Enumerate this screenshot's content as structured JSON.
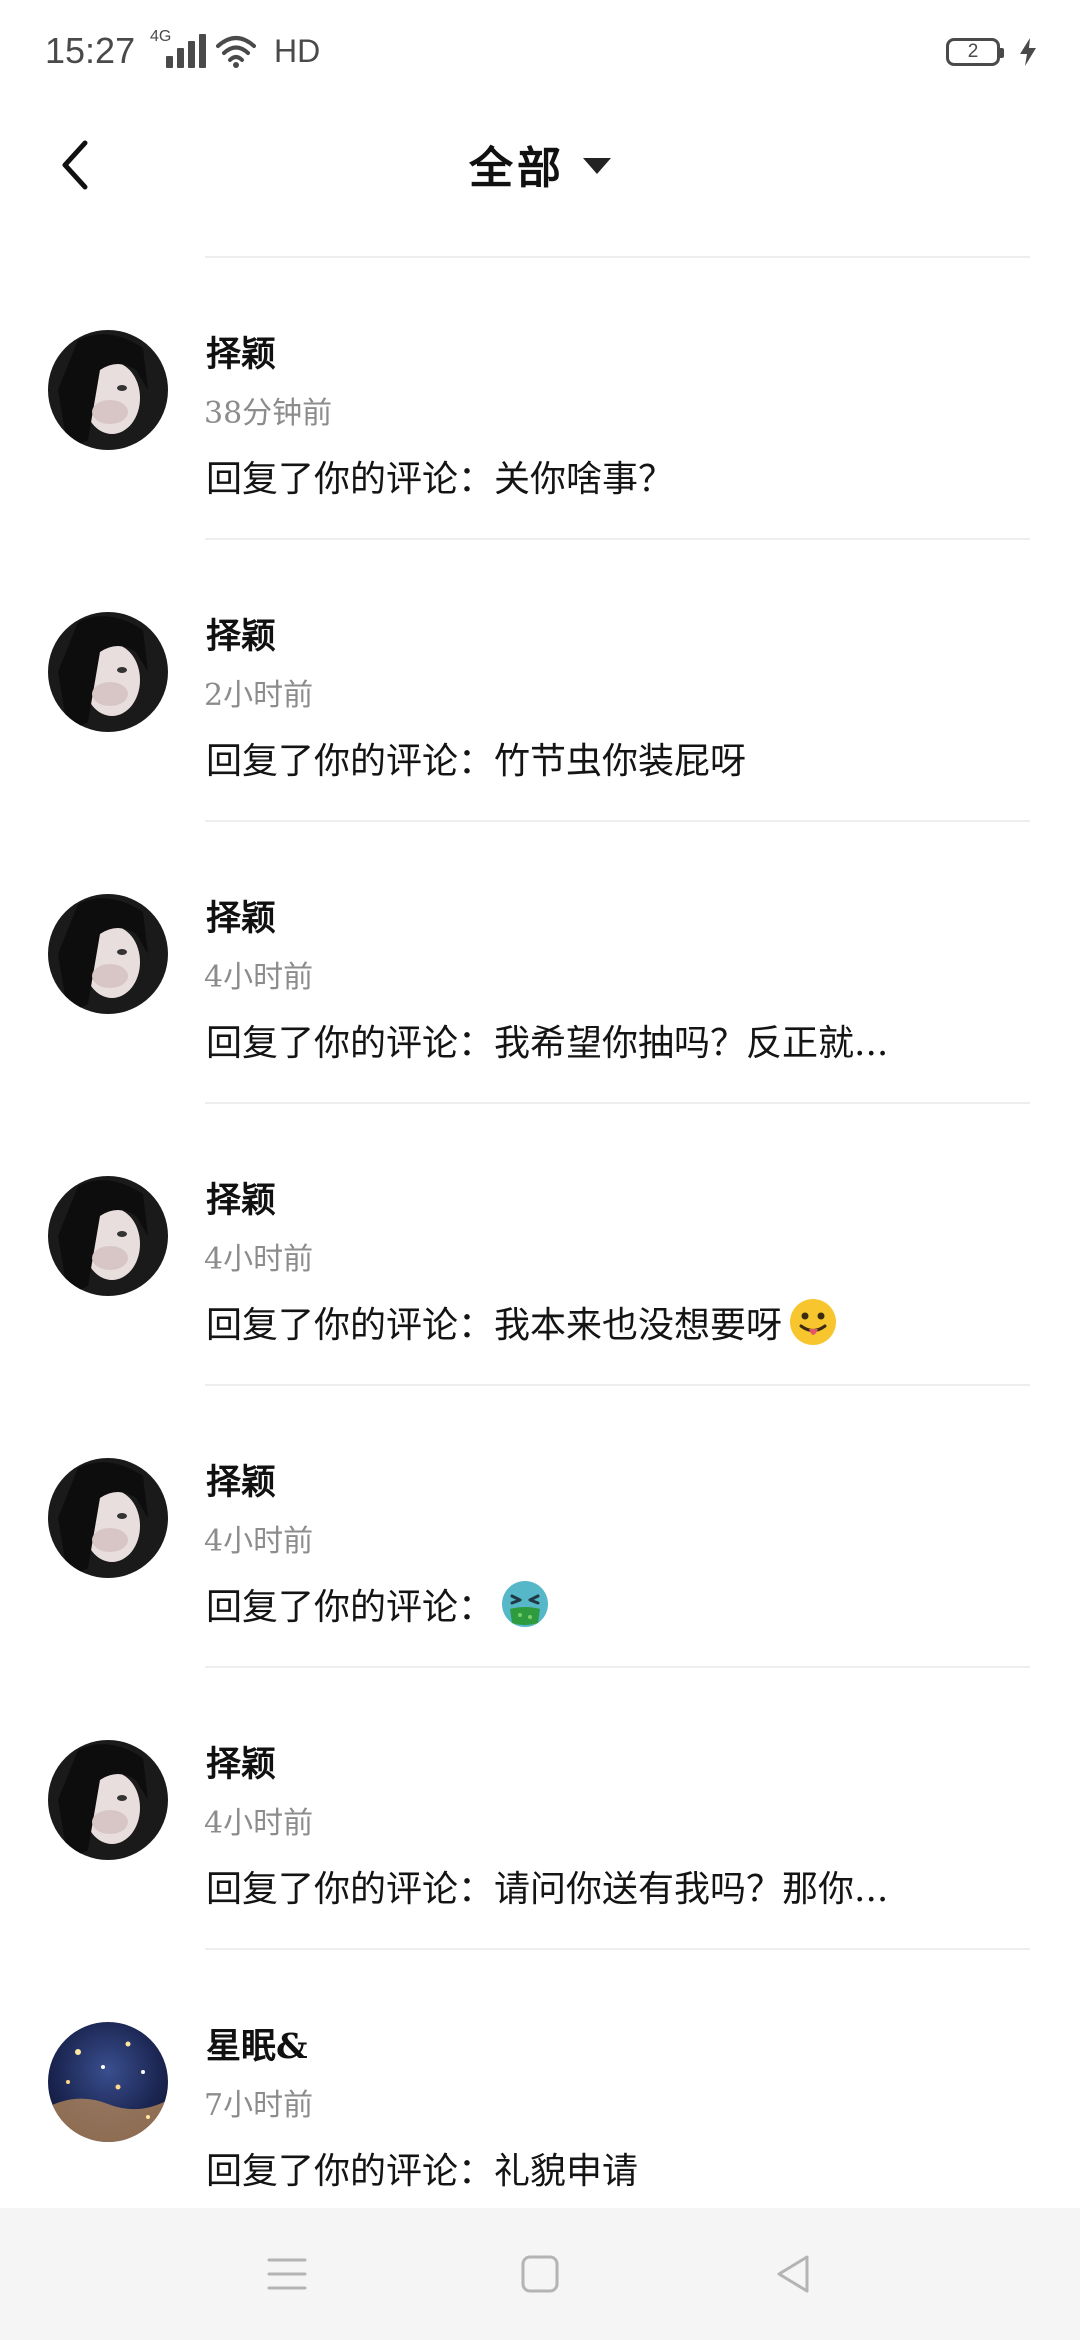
{
  "status_bar": {
    "time": "15:27",
    "network": "4G",
    "quality": "HD",
    "battery_level": "2"
  },
  "header": {
    "title": "全部"
  },
  "items": [
    {
      "name": "择颖",
      "time": "38分钟前",
      "text": "回复了你的评论：关你啥事？",
      "emoji": "",
      "avatar": "dark-hair-avatar"
    },
    {
      "name": "择颖",
      "time": "2小时前",
      "text": "回复了你的评论：竹节虫你装屁呀",
      "emoji": "",
      "avatar": "dark-hair-avatar"
    },
    {
      "name": "择颖",
      "time": "4小时前",
      "text": "回复了你的评论：我希望你抽吗？反正就...",
      "emoji": "",
      "avatar": "dark-hair-avatar"
    },
    {
      "name": "择颖",
      "time": "4小时前",
      "text": "回复了你的评论：我本来也没想要呀",
      "emoji": "tongue-out-emoji",
      "avatar": "dark-hair-avatar"
    },
    {
      "name": "择颖",
      "time": "4小时前",
      "text": "回复了你的评论：",
      "emoji": "vomit-emoji",
      "avatar": "dark-hair-avatar"
    },
    {
      "name": "择颖",
      "time": "4小时前",
      "text": "回复了你的评论：请问你送有我吗？那你...",
      "emoji": "",
      "avatar": "dark-hair-avatar"
    },
    {
      "name": "星眠&",
      "time": "7小时前",
      "text": "回复了你的评论：礼貌申请",
      "emoji": "",
      "avatar": "starry-sky-avatar"
    }
  ],
  "nav": {
    "menu": "menu-icon",
    "home": "home-square-icon",
    "back": "back-triangle-icon"
  },
  "colors": {
    "background": "#ffffff",
    "divider": "#eeeeee",
    "secondary_text": "#8c8c8c",
    "nav_bar": "#f5f5f5"
  }
}
